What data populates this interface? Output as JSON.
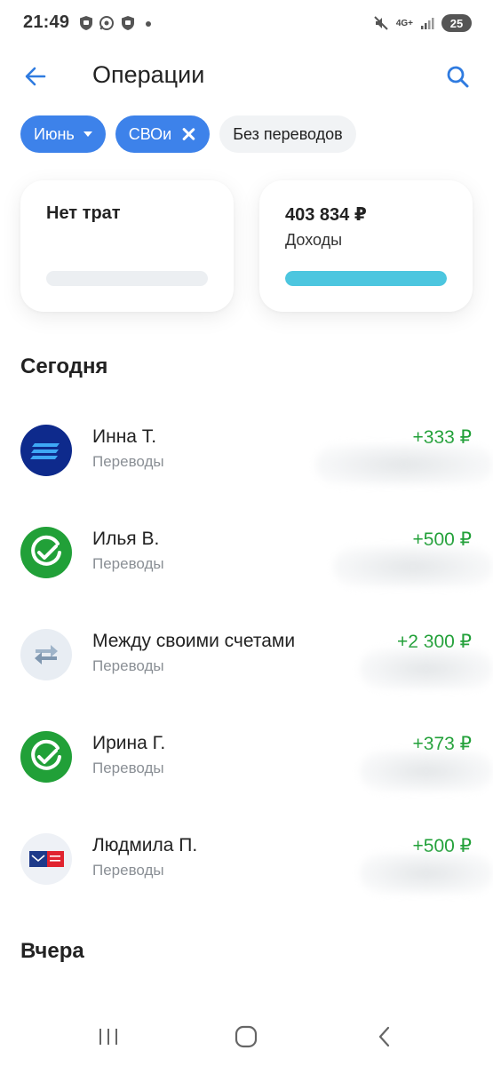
{
  "status_bar": {
    "time": "21:49",
    "network": "4G+",
    "battery": "25",
    "icons": [
      "shield-icon",
      "whatsapp-icon",
      "shield-icon",
      "dot-icon",
      "mute-icon",
      "signal-icon"
    ]
  },
  "header": {
    "title": "Операции",
    "back_icon": "arrow-left-icon",
    "search_icon": "search-icon"
  },
  "filters": {
    "month": "Июнь",
    "category": "СВОи",
    "no_transfers": "Без переводов"
  },
  "summary": {
    "expenses": {
      "title": "Нет трат",
      "fill": 0
    },
    "income": {
      "title": "403 834 ₽",
      "label": "Доходы",
      "fill": 1
    }
  },
  "sections": {
    "today": "Сегодня",
    "yesterday": "Вчера"
  },
  "operations": [
    {
      "name": "Инна Т.",
      "category": "Переводы",
      "amount": "+333 ₽",
      "avatar": "bank-stripes-icon"
    },
    {
      "name": "Илья В.",
      "category": "Переводы",
      "amount": "+500 ₽",
      "avatar": "sber-check-icon"
    },
    {
      "name": "Между своими счетами",
      "category": "Переводы",
      "amount": "+2 300 ₽",
      "avatar": "transfer-arrows-icon"
    },
    {
      "name": "Ирина Г.",
      "category": "Переводы",
      "amount": "+373 ₽",
      "avatar": "sber-check-icon"
    },
    {
      "name": "Людмила П.",
      "category": "Переводы",
      "amount": "+500 ₽",
      "avatar": "pochta-bank-icon"
    }
  ],
  "colors": {
    "accent": "#3d82ea",
    "income": "#21a038",
    "bar": "#4cc6df"
  },
  "nav": {
    "recent_icon": "recent-apps-icon",
    "home_icon": "home-icon",
    "back_icon": "back-chevron-icon"
  }
}
